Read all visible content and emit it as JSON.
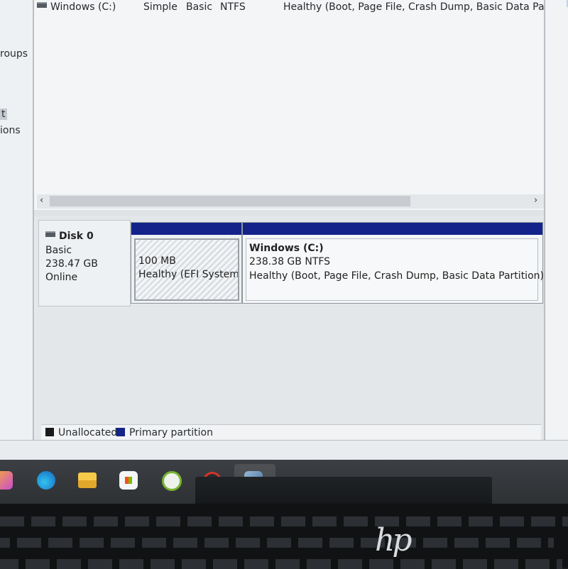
{
  "sidebar": {
    "items": [
      {
        "label": "roups"
      },
      {
        "label": "t"
      },
      {
        "label": "ions"
      }
    ]
  },
  "volume_list": {
    "row": {
      "name": "Windows (C:)",
      "layout": "Simple",
      "type": "Basic",
      "file_system": "NTFS",
      "status": "Healthy (Boot, Page File, Crash Dump, Basic Data Partition"
    },
    "scroll_left": "‹",
    "scroll_right": "›"
  },
  "disk": {
    "name": "Disk 0",
    "type": "Basic",
    "size": "238.47 GB",
    "status": "Online",
    "partitions": [
      {
        "size": "100 MB",
        "status": "Healthy (EFI System P"
      },
      {
        "name": "Windows  (C:)",
        "size_fs": "238.38 GB NTFS",
        "status": "Healthy (Boot, Page File, Crash Dump, Basic Data Partition)"
      }
    ]
  },
  "legend": {
    "unallocated": "Unallocated",
    "primary": "Primary partition",
    "unallocated_color": "#1a1a1a",
    "primary_color": "#13238a"
  },
  "taskbar": {
    "icons": [
      "copilot-icon",
      "edge-icon",
      "file-explorer-icon",
      "store-icon",
      "green-app-icon",
      "red-app-icon",
      "disk-management-icon"
    ]
  },
  "laptop": {
    "brand": "hp"
  }
}
